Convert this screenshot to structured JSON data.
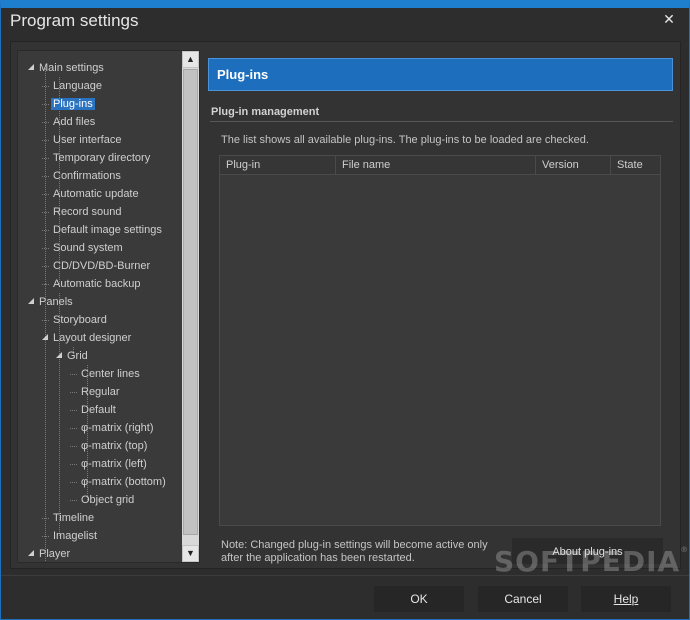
{
  "window": {
    "title": "Program settings"
  },
  "tree": {
    "nodes": [
      {
        "label": "Main settings",
        "level": 0,
        "expanded": true
      },
      {
        "label": "Language",
        "level": 1
      },
      {
        "label": "Plug-ins",
        "level": 1,
        "selected": true
      },
      {
        "label": "Add files",
        "level": 1
      },
      {
        "label": "User interface",
        "level": 1
      },
      {
        "label": "Temporary directory",
        "level": 1
      },
      {
        "label": "Confirmations",
        "level": 1
      },
      {
        "label": "Automatic update",
        "level": 1
      },
      {
        "label": "Record sound",
        "level": 1
      },
      {
        "label": "Default image settings",
        "level": 1
      },
      {
        "label": "Sound system",
        "level": 1
      },
      {
        "label": "CD/DVD/BD-Burner",
        "level": 1
      },
      {
        "label": "Automatic backup",
        "level": 1
      },
      {
        "label": "Panels",
        "level": 0,
        "expanded": true
      },
      {
        "label": "Storyboard",
        "level": 1
      },
      {
        "label": "Layout designer",
        "level": 1,
        "expanded": true
      },
      {
        "label": "Grid",
        "level": 2,
        "expanded": true
      },
      {
        "label": "Center lines",
        "level": 3
      },
      {
        "label": "Regular",
        "level": 3
      },
      {
        "label": "Default",
        "level": 3
      },
      {
        "label": "φ-matrix (right)",
        "level": 3
      },
      {
        "label": "φ-matrix (top)",
        "level": 3
      },
      {
        "label": "φ-matrix (left)",
        "level": 3
      },
      {
        "label": "φ-matrix (bottom)",
        "level": 3
      },
      {
        "label": "Object grid",
        "level": 3
      },
      {
        "label": "Timeline",
        "level": 1
      },
      {
        "label": "Imagelist",
        "level": 1
      },
      {
        "label": "Player",
        "level": 0,
        "expanded": true
      }
    ]
  },
  "panel": {
    "header": "Plug-ins",
    "section_title": "Plug-in management",
    "description": "The list shows all available plug-ins. The plug-ins to be loaded are checked.",
    "columns": [
      "Plug-in",
      "File name",
      "Version",
      "State"
    ],
    "note": "Note: Changed plug-in settings will become active only after the application has been restarted.",
    "about_button": "About plug-ins"
  },
  "watermark": "SOFTPEDIA",
  "footer": {
    "ok": "OK",
    "cancel": "Cancel",
    "help": "Help"
  }
}
